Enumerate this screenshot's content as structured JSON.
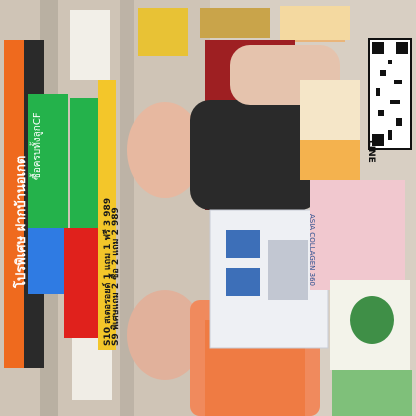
{
  "overlay": {
    "headline": "โปรพิเศษ ฝากบ้านอเกต",
    "subline": "ซื้อครบทั้งลูกCF",
    "promo_1": "S10 สเตอรอยด์ 1 แถม 1 ฟรี 3  989",
    "promo_2": "S9 พิเศษแถม 2 ซื้อ 2 แถม 2  989"
  },
  "qr": {
    "label": "LINE"
  },
  "product": {
    "box_text": "ASIA COLLAGEN 360"
  },
  "colors": {
    "orange": "#ef6a1e",
    "green": "#24b24b",
    "blue": "#2f7be3",
    "red": "#e0211c",
    "yellow": "#f3c62a"
  }
}
